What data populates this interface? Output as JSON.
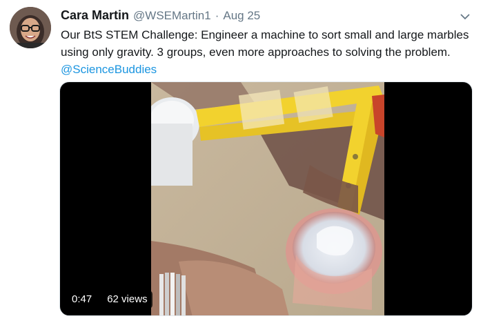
{
  "tweet": {
    "name": "Cara Martin",
    "handle": "@WSEMartin1",
    "separator": "·",
    "date": "Aug 25",
    "text_line1": "Our BtS STEM Challenge: Engineer a machine to sort small and large marbles",
    "text_line2": "using only gravity. 3 groups, even more approaches to solving the problem.",
    "mention": "@ScienceBuddies"
  },
  "media": {
    "duration": "0:47",
    "views": "62 views"
  },
  "icons": {
    "menu": "chevron-down-icon"
  },
  "colors": {
    "link": "#1b95e0",
    "secondary_text": "#657786",
    "tape_yellow": "#f2d22e"
  }
}
